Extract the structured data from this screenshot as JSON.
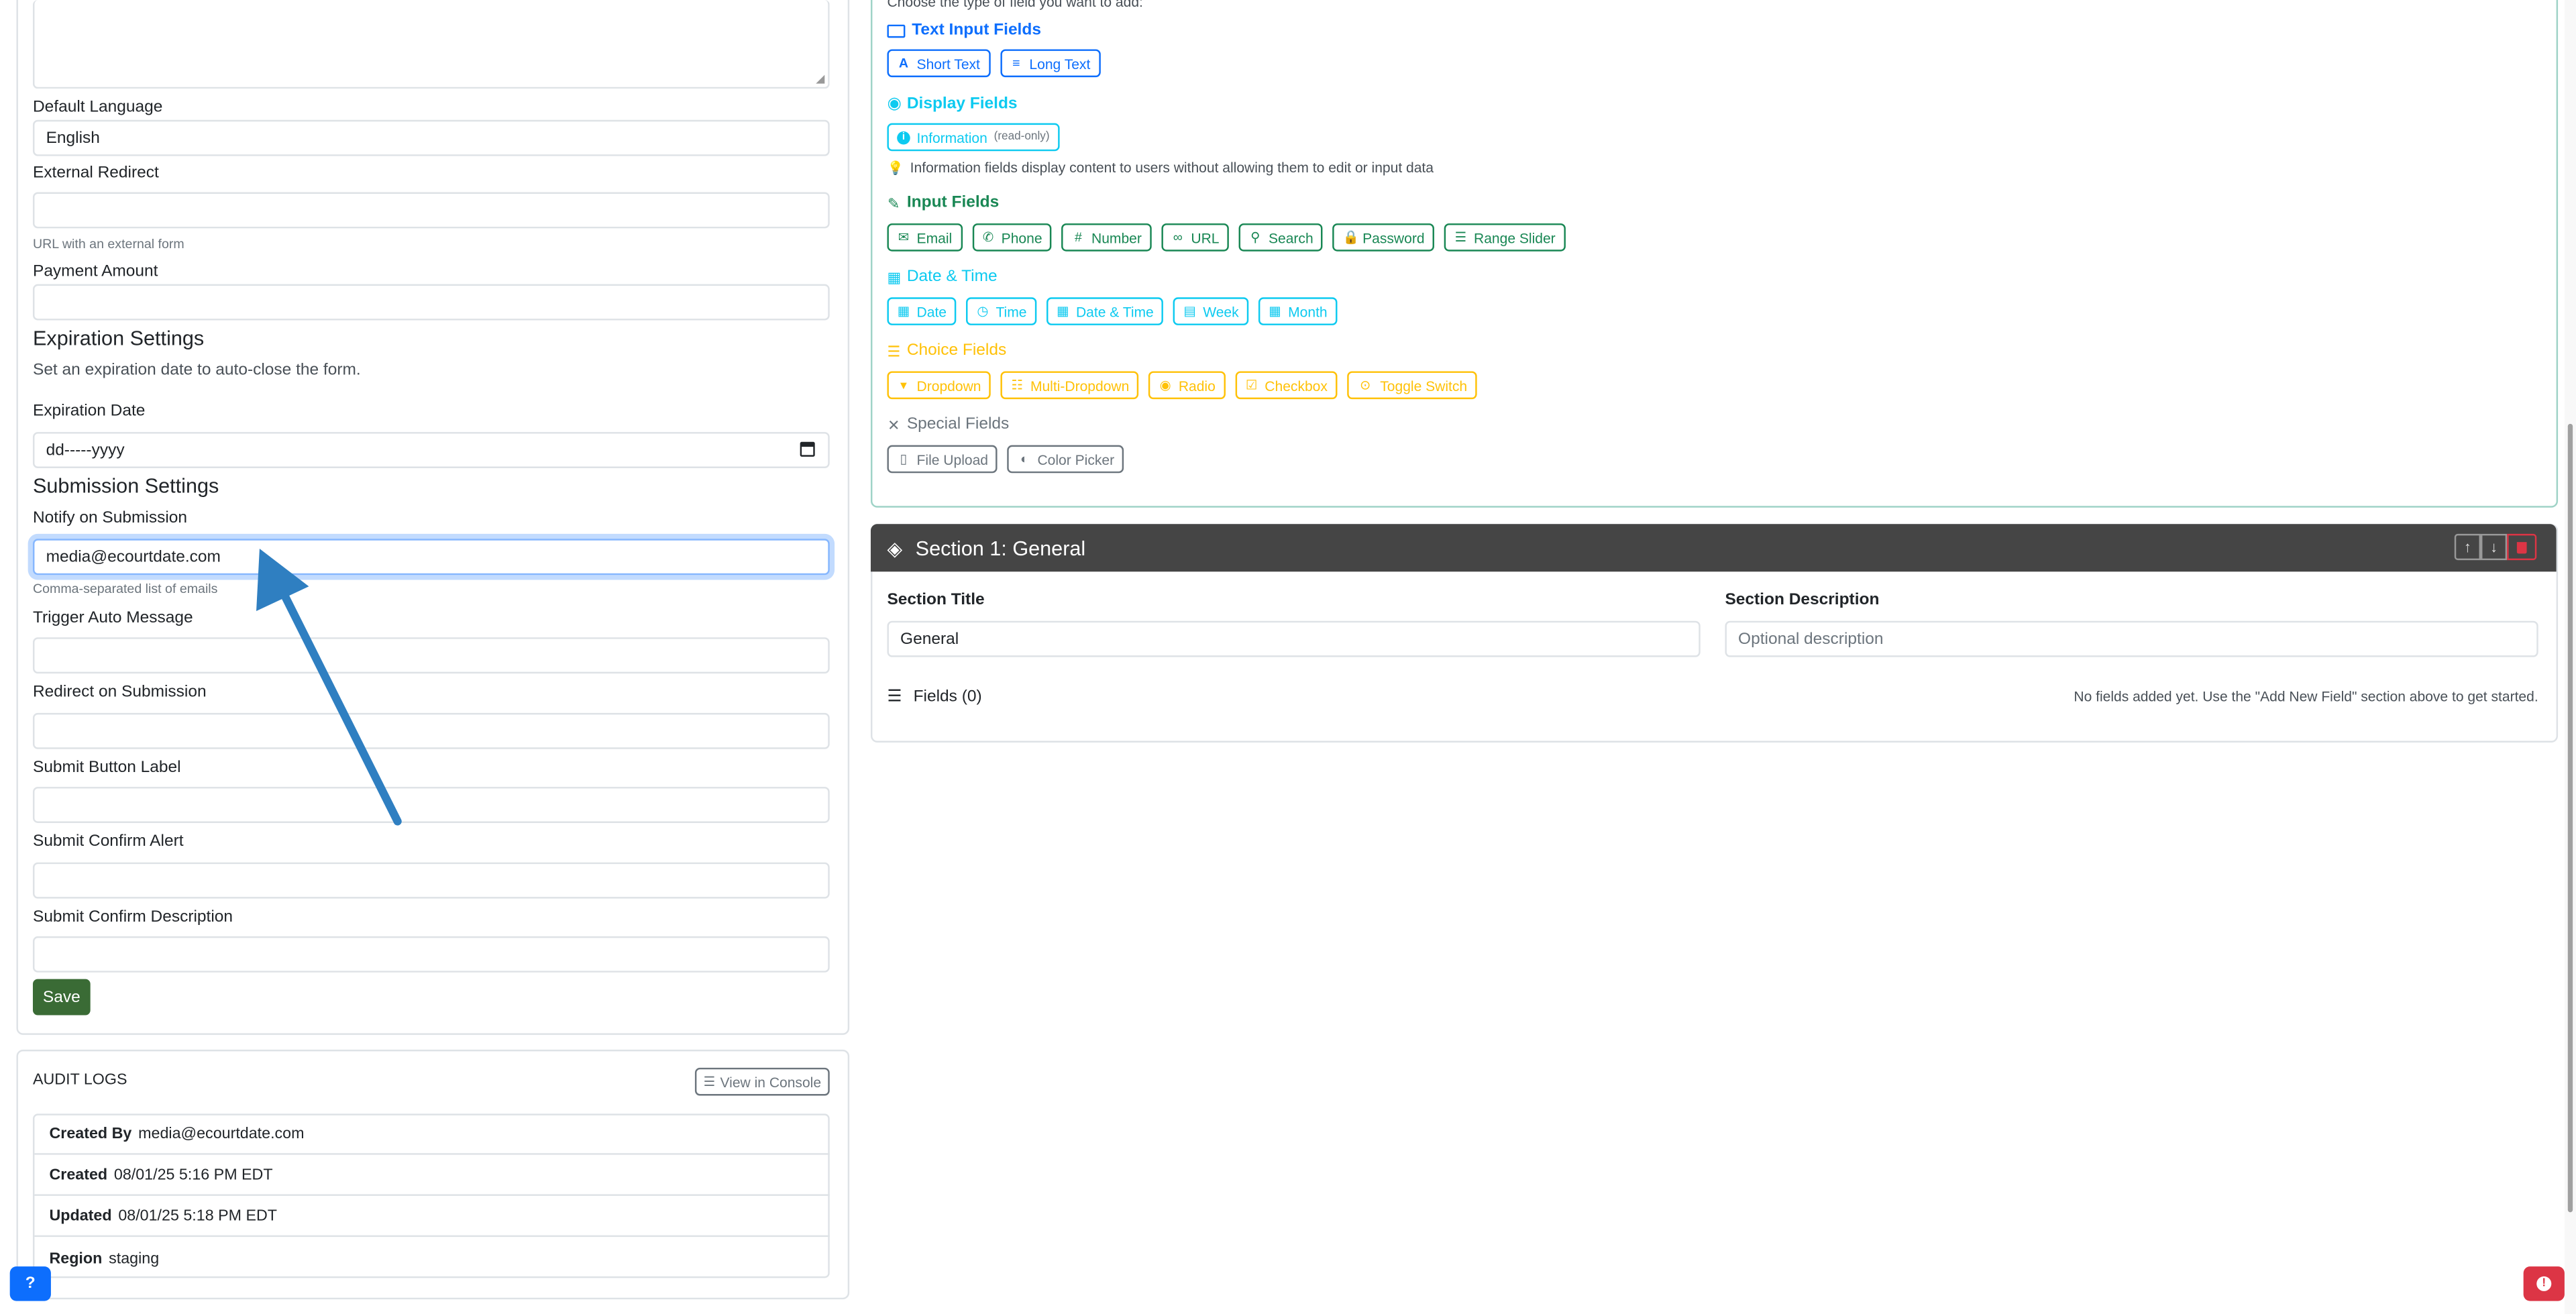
{
  "left": {
    "default_language_label": "Default Language",
    "default_language_value": "English",
    "external_redirect_label": "External Redirect",
    "external_redirect_help": "URL with an external form",
    "payment_amount_label": "Payment Amount",
    "expiration_heading": "Expiration Settings",
    "expiration_desc": "Set an expiration date to auto-close the form.",
    "expiration_date_label": "Expiration Date",
    "expiration_date_value": "dd-----yyyy",
    "submission_heading": "Submission Settings",
    "notify_label": "Notify on Submission",
    "notify_value": "media@ecourtdate.com",
    "notify_help": "Comma-separated list of emails",
    "trigger_label": "Trigger Auto Message",
    "redirect_label": "Redirect on Submission",
    "submit_label_label": "Submit Button Label",
    "confirm_alert_label": "Submit Confirm Alert",
    "confirm_desc_label": "Submit Confirm Description",
    "save_button": "Save"
  },
  "audit": {
    "title": "AUDIT LOGS",
    "console_button": "View in Console",
    "rows": [
      {
        "key": "Created By",
        "value": "media@ecourtdate.com"
      },
      {
        "key": "Created",
        "value": "08/01/25 5:16 PM EDT"
      },
      {
        "key": "Updated",
        "value": "08/01/25 5:18 PM EDT"
      },
      {
        "key": "Region",
        "value": "staging"
      }
    ]
  },
  "fields": {
    "intro": "Choose the type of field you want to add:",
    "text_input": {
      "title": "Text Input Fields",
      "items": [
        "Short Text",
        "Long Text"
      ]
    },
    "display": {
      "title": "Display Fields",
      "item": "Information",
      "item_note": "(read-only)",
      "hint": "Information fields display content to users without allowing them to edit or input data"
    },
    "input": {
      "title": "Input Fields",
      "items": [
        "Email",
        "Phone",
        "Number",
        "URL",
        "Search",
        "Password",
        "Range Slider"
      ]
    },
    "datetime": {
      "title": "Date & Time",
      "items": [
        "Date",
        "Time",
        "Date & Time",
        "Week",
        "Month"
      ]
    },
    "choice": {
      "title": "Choice Fields",
      "items": [
        "Dropdown",
        "Multi-Dropdown",
        "Radio",
        "Checkbox",
        "Toggle Switch"
      ]
    },
    "special": {
      "title": "Special Fields",
      "items": [
        "File Upload",
        "Color Picker"
      ]
    }
  },
  "section": {
    "header": "Section 1: General",
    "title_label": "Section Title",
    "title_value": "General",
    "desc_label": "Section Description",
    "desc_placeholder": "Optional description",
    "fields_label": "Fields (0)",
    "empty_msg": "No fields added yet. Use the \"Add New Field\" section above to get started."
  },
  "colors": {
    "primary": "#0d6efd",
    "info": "#0dcaf0",
    "success": "#198754",
    "warning": "#ffc107",
    "danger": "#dc3545",
    "save": "#3a6b35",
    "arrow": "#2f7fc1"
  }
}
